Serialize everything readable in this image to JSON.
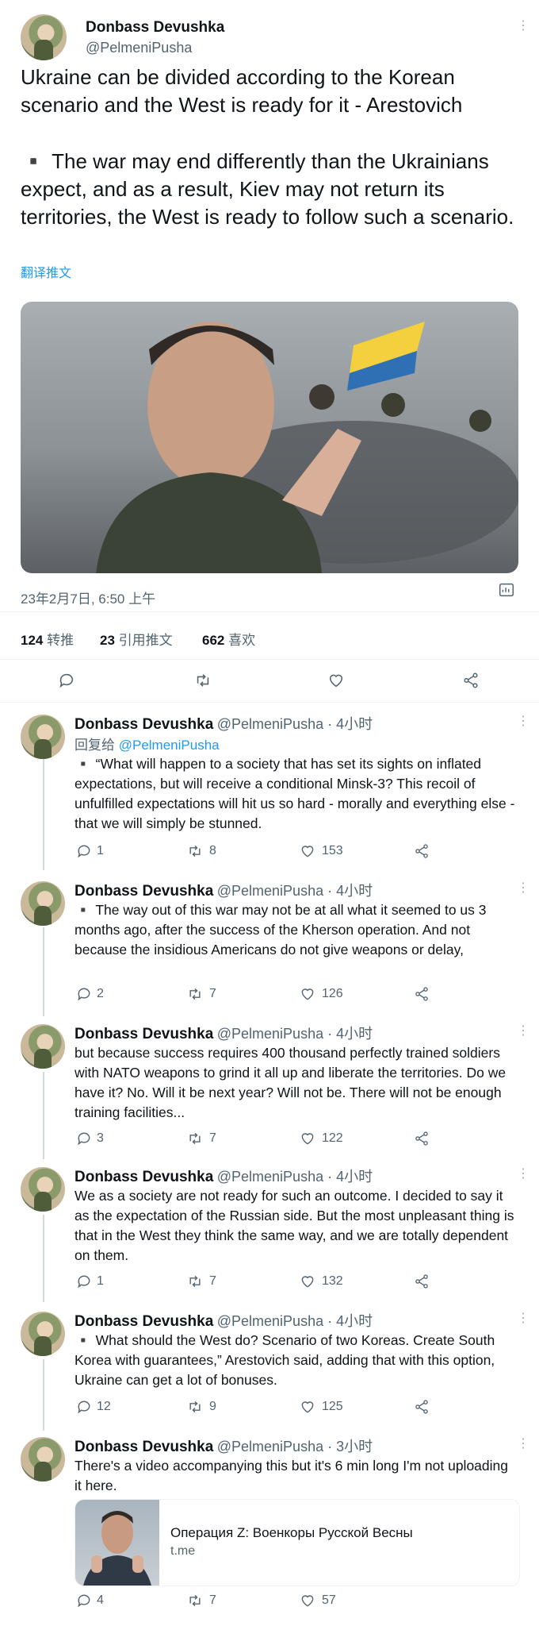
{
  "main_tweet": {
    "author": "Donbass Devushka",
    "handle": "@PelmeniPusha",
    "headline": "Ukraine can be divided according to the Korean scenario and the West is ready for it - Arestovich",
    "body": "▪️ The war may end differently than the Ukrainians expect, and as a result, Kiev may not return its territories, the West is ready to follow such a scenario.",
    "translate_label": "翻译推文",
    "timestamp": "23年2月7日, 6:50 上午",
    "retweets_count": "124",
    "retweets_label": "转推",
    "quotes_count": "23",
    "quotes_label": "引用推文",
    "likes_count": "662",
    "likes_label": "喜欢"
  },
  "replies": [
    {
      "author": "Donbass Devushka",
      "handle_time": "@PelmeniPusha · 4小时",
      "reply_prefix": "回复给",
      "reply_to": "@PelmeniPusha",
      "text": "▪️ “What will happen to a society that has set its sights on inflated expectations, but will receive a conditional Minsk-3? This recoil of unfulfilled expectations will hit us so hard - morally and everything else - that we will simply be stunned.",
      "replies": "1",
      "retweets": "8",
      "likes": "153"
    },
    {
      "author": "Donbass Devushka",
      "handle_time": "@PelmeniPusha · 4小时",
      "text": "▪️ The way out of this war may not be at all what it seemed to us 3 months ago, after the success of the Kherson operation. And not because the insidious Americans do not give weapons or delay,",
      "replies": "2",
      "retweets": "7",
      "likes": "126"
    },
    {
      "author": "Donbass Devushka",
      "handle_time": "@PelmeniPusha · 4小时",
      "text": "but because success requires 400 thousand perfectly trained soldiers with NATO weapons to grind it all up and liberate the territories. Do we have it? No. Will it be next year? Will not be. There will not be enough training facilities...",
      "replies": "3",
      "retweets": "7",
      "likes": "122"
    },
    {
      "author": "Donbass Devushka",
      "handle_time": "@PelmeniPusha · 4小时",
      "text": "We as a society are not ready for such an outcome. I decided to say it as the expectation of the Russian side. But the most unpleasant thing is that in the West they think the same way, and we are totally dependent on them.",
      "replies": "1",
      "retweets": "7",
      "likes": "132"
    },
    {
      "author": "Donbass Devushka",
      "handle_time": "@PelmeniPusha · 4小时",
      "text": "▪️ What should the West do? Scenario of two Koreas. Create South Korea with guarantees,” Arestovich said, adding that with this option, Ukraine can get a lot of bonuses.",
      "replies": "12",
      "retweets": "9",
      "likes": "125"
    },
    {
      "author": "Donbass Devushka",
      "handle_time": "@PelmeniPusha · 3小时",
      "text": "There's a video accompanying this but it's 6 min long I'm not uploading it here.",
      "card_title": "Операция Z: Военкоры Русской Весны",
      "card_domain": "t.me",
      "replies": "4",
      "retweets": "7",
      "likes": "57"
    }
  ],
  "colors": {
    "link": "#1d9bf0",
    "secondary": "#536471",
    "border": "#eff3f4"
  },
  "icons": [
    "more-icon",
    "reply-icon",
    "retweet-icon",
    "like-icon",
    "share-icon",
    "analytics-icon"
  ]
}
